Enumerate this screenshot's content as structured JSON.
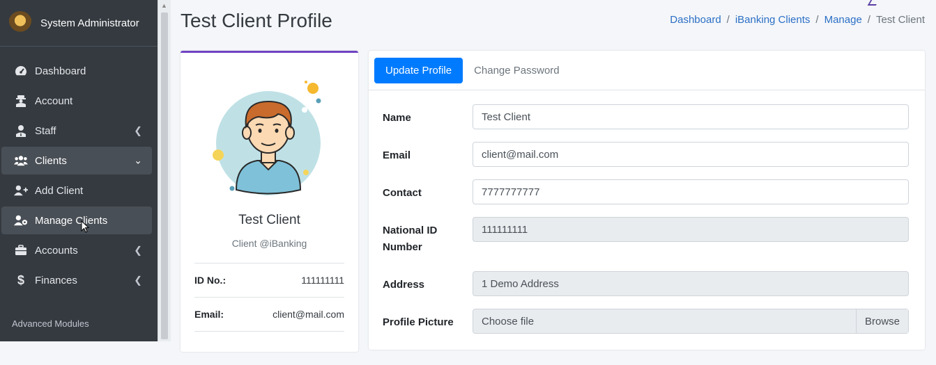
{
  "sidebar": {
    "brand": "System Administrator",
    "items": [
      {
        "label": "Dashboard",
        "icon": "tachometer-icon"
      },
      {
        "label": "Account",
        "icon": "user-secret-icon"
      },
      {
        "label": "Staff",
        "icon": "user-tie-icon"
      },
      {
        "label": "Clients",
        "icon": "users-icon"
      },
      {
        "label": "Add Client",
        "icon": "user-plus-icon"
      },
      {
        "label": "Manage Clients",
        "icon": "user-cog-icon"
      },
      {
        "label": "Accounts",
        "icon": "briefcase-icon"
      },
      {
        "label": "Finances",
        "icon": "dollar-icon"
      }
    ],
    "section_header": "Advanced Modules"
  },
  "header": {
    "title": "Test Client Profile",
    "breadcrumb": [
      "Dashboard",
      "iBanking Clients",
      "Manage",
      "Test Client"
    ]
  },
  "profile": {
    "name": "Test Client",
    "subtitle": "Client @iBanking",
    "id_label": "ID No.:",
    "id_value": "111111111",
    "email_label": "Email:",
    "email_value": "client@mail.com"
  },
  "tabs": {
    "update": "Update Profile",
    "password": "Change Password"
  },
  "form": {
    "name_label": "Name",
    "name_value": "Test Client",
    "email_label": "Email",
    "email_value": "client@mail.com",
    "contact_label": "Contact",
    "contact_value": "7777777777",
    "national_label": "National ID Number",
    "national_value": "111111111",
    "address_label": "Address",
    "address_value": "1 Demo Address",
    "picture_label": "Profile Picture",
    "picture_placeholder": "Choose file",
    "browse_label": "Browse"
  },
  "colors": {
    "sidebar": "#343a40",
    "accent": "#007bff",
    "card_top": "#6f42c1"
  }
}
